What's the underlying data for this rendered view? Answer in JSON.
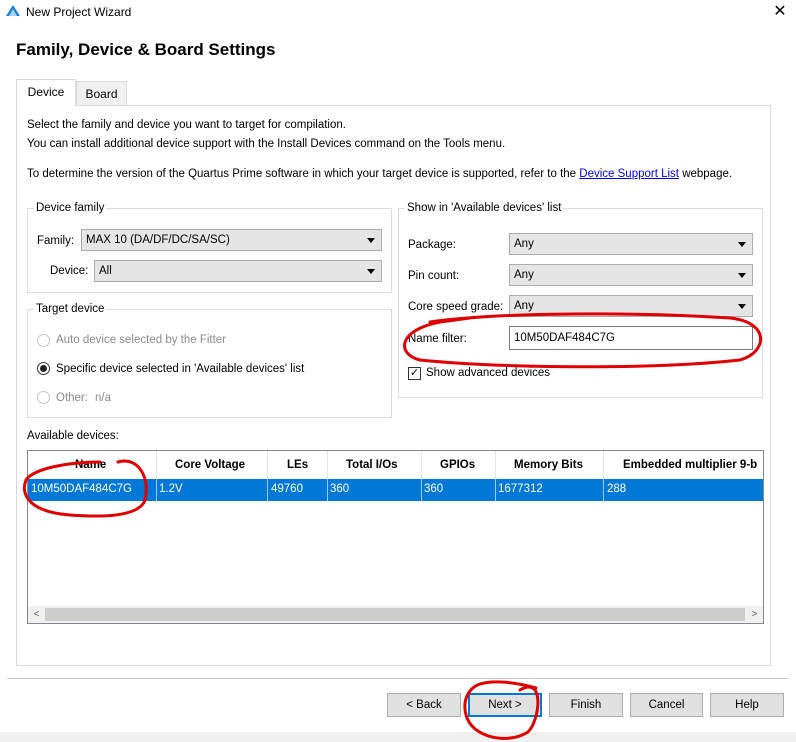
{
  "window": {
    "title": "New Project Wizard",
    "close_glyph": "✕"
  },
  "page": {
    "heading": "Family, Device & Board Settings"
  },
  "tabs": [
    {
      "label": "Device"
    },
    {
      "label": "Board"
    }
  ],
  "info": {
    "line1": "Select the family and device you want to target for compilation.",
    "line2": "You can install additional device support with the Install Devices command on the Tools menu.",
    "line3_before": "To determine the version of the Quartus Prime software in which your target device is supported, refer to the ",
    "line3_link": "Device Support List",
    "line3_after": " webpage."
  },
  "device_family": {
    "title": "Device family",
    "family_label": "Family:",
    "family_value": "MAX 10 (DA/DF/DC/SA/SC)",
    "device_label": "Device:",
    "device_value": "All"
  },
  "target_device": {
    "title": "Target device",
    "options": [
      {
        "label": "Auto device selected by the Fitter",
        "checked": false,
        "enabled": false
      },
      {
        "label": "Specific device selected in 'Available devices' list",
        "checked": true,
        "enabled": true
      },
      {
        "label": "Other:",
        "value": "n/a",
        "checked": false,
        "enabled": false
      }
    ]
  },
  "show_in_list": {
    "title": "Show in 'Available devices' list",
    "package_label": "Package:",
    "package_value": "Any",
    "pin_count_label": "Pin count:",
    "pin_count_value": "Any",
    "speed_label": "Core speed grade:",
    "speed_value": "Any",
    "name_filter_label": "Name filter:",
    "name_filter_value": "10M50DAF484C7G",
    "advanced_label": "Show advanced devices",
    "advanced_checked": true
  },
  "available_devices": {
    "label": "Available devices:",
    "columns": [
      "Name",
      "Core Voltage",
      "LEs",
      "Total I/Os",
      "GPIOs",
      "Memory Bits",
      "Embedded multiplier 9-b"
    ],
    "rows": [
      [
        "10M50DAF484C7G",
        "1.2V",
        "49760",
        "360",
        "360",
        "1677312",
        "288"
      ]
    ]
  },
  "buttons": {
    "back": "< Back",
    "next": "Next >",
    "finish": "Finish",
    "cancel": "Cancel",
    "help": "Help"
  },
  "colors": {
    "selection": "#0078d7",
    "annotation": "#e00000"
  }
}
